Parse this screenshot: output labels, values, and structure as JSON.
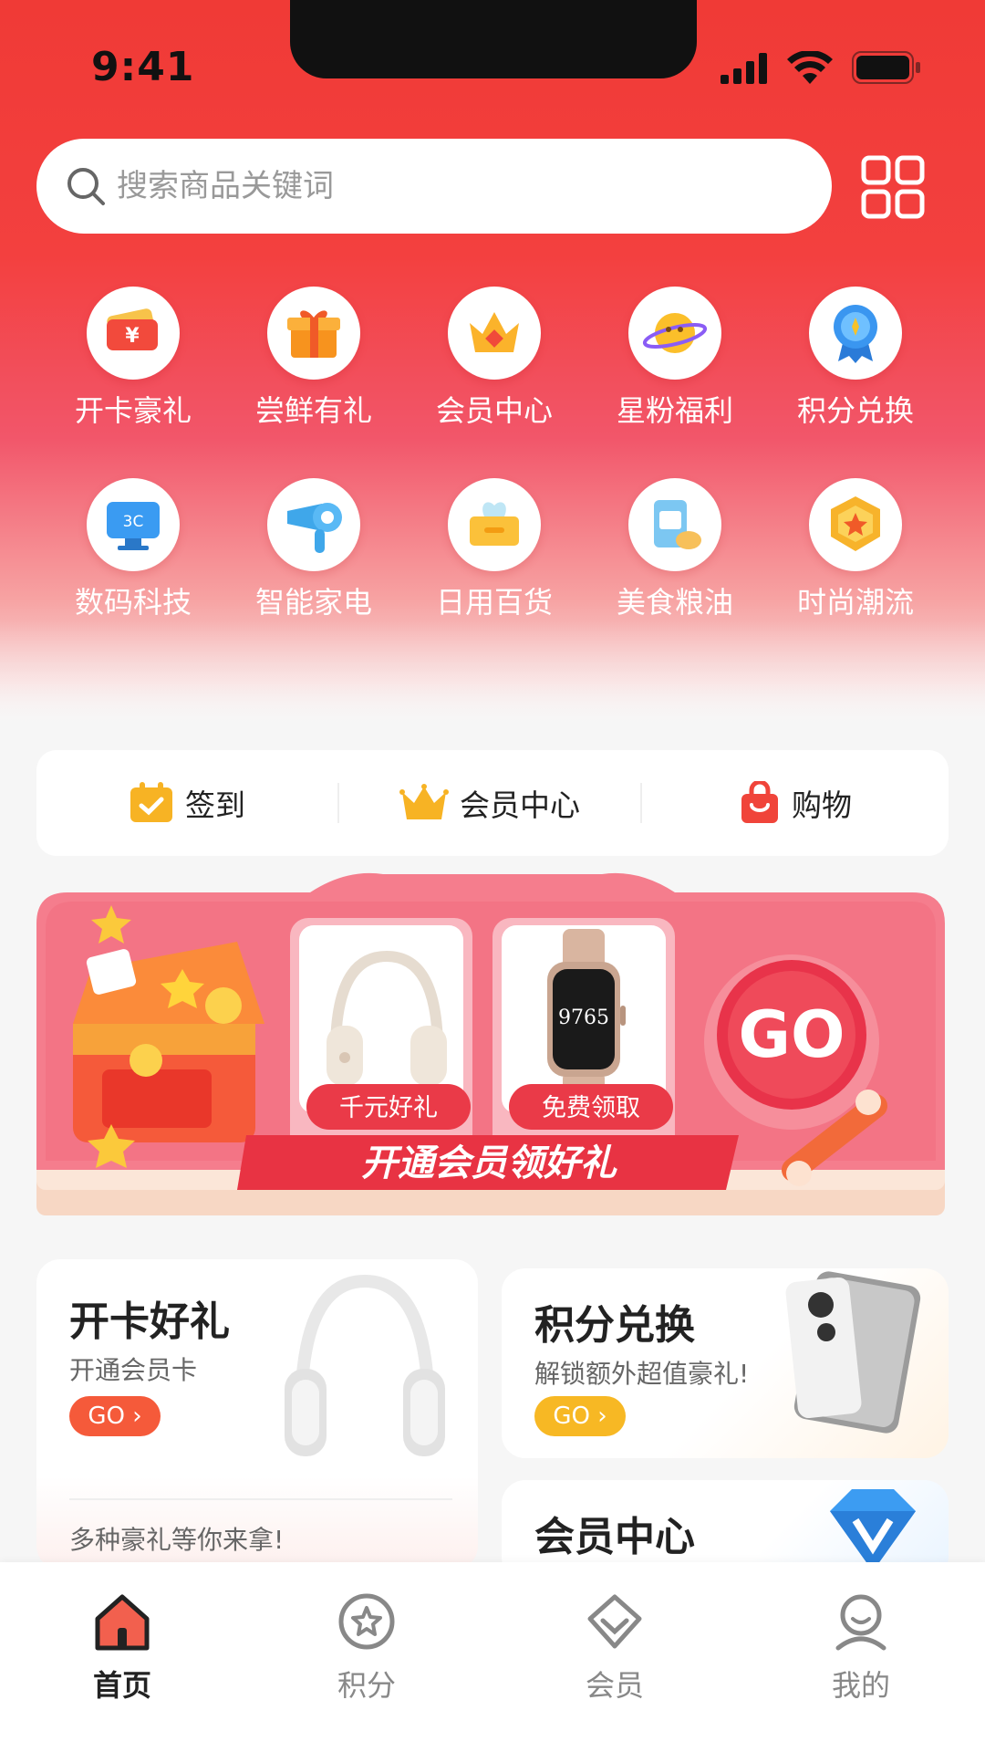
{
  "status_bar": {
    "time": "9:41"
  },
  "search": {
    "placeholder": "搜索商品关键词"
  },
  "categories": [
    {
      "label": "开卡豪礼",
      "icon": "ticket-icon"
    },
    {
      "label": "尝鲜有礼",
      "icon": "gift-box-icon"
    },
    {
      "label": "会员中心",
      "icon": "crown-icon"
    },
    {
      "label": "星粉福利",
      "icon": "planet-icon"
    },
    {
      "label": "积分兑换",
      "icon": "medal-icon"
    },
    {
      "label": "数码科技",
      "icon": "monitor-3c-icon"
    },
    {
      "label": "智能家电",
      "icon": "hair-dryer-icon"
    },
    {
      "label": "日用百货",
      "icon": "tissue-box-icon"
    },
    {
      "label": "美食粮油",
      "icon": "rice-bag-icon"
    },
    {
      "label": "时尚潮流",
      "icon": "star-badge-icon"
    }
  ],
  "category_icon_text": "3C",
  "quick_links": [
    {
      "label": "签到",
      "icon": "calendar-check-icon"
    },
    {
      "label": "会员中心",
      "icon": "crown-icon"
    },
    {
      "label": "购物",
      "icon": "shopping-bag-icon"
    }
  ],
  "banner": {
    "tag1": "千元好礼",
    "tag2": "免费领取",
    "go_text": "GO",
    "slogan": "开通会员领好礼",
    "watch_face": "9765"
  },
  "promo_cards": {
    "card1": {
      "title": "开卡好礼",
      "subtitle": "开通会员卡",
      "go": "GO",
      "footer": "多种豪礼等你来拿!"
    },
    "card2": {
      "title": "积分兑换",
      "subtitle": "解锁额外超值豪礼!",
      "go": "GO"
    },
    "card3": {
      "title": "会员中心"
    }
  },
  "tabbar": [
    {
      "label": "首页",
      "icon": "home-icon",
      "active": true
    },
    {
      "label": "积分",
      "icon": "star-circle-icon",
      "active": false
    },
    {
      "label": "会员",
      "icon": "diamond-icon",
      "active": false
    },
    {
      "label": "我的",
      "icon": "user-icon",
      "active": false
    }
  ],
  "colors": {
    "brand_red": "#f03a36",
    "go_orange": "#f55a3a",
    "go_yellow": "#f7b824",
    "active_tab": "#222222",
    "inactive_tab": "#888888"
  }
}
